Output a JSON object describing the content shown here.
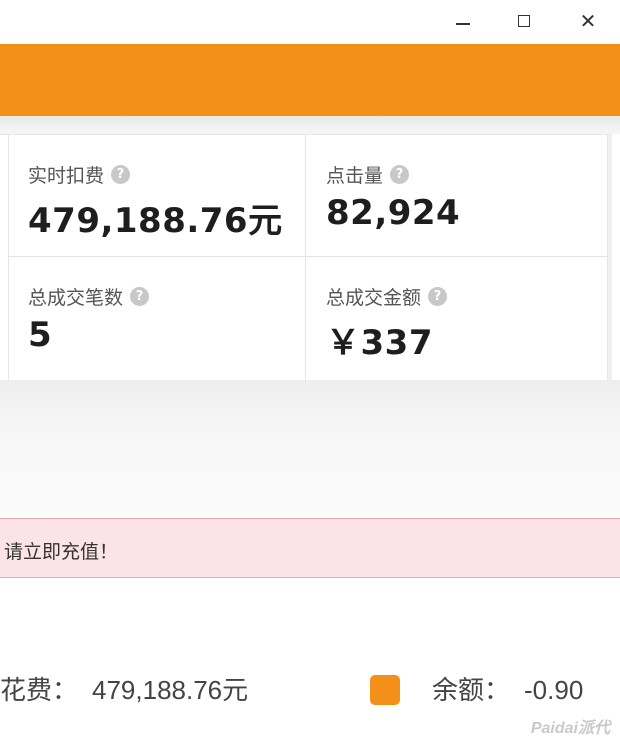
{
  "stats": [
    {
      "label": "实时扣费",
      "value": "479,188.76元"
    },
    {
      "label": "点击量",
      "value": "82,924"
    },
    {
      "label": "总成交笔数",
      "value": "5"
    },
    {
      "label": "总成交金额",
      "value": "￥337"
    }
  ],
  "alert": {
    "text": "请立即充值！"
  },
  "summary": {
    "spend_label": "花费：",
    "spend_value": "479,188.76元",
    "balance_label": "余额：",
    "balance_value": "-0.90"
  },
  "watermark": "Paidai派代",
  "colors": {
    "accent": "#f39019",
    "alert_bg": "#fce3e8",
    "alert_border": "#e7a8b4"
  },
  "icons": {
    "help": "question-circle-icon"
  }
}
